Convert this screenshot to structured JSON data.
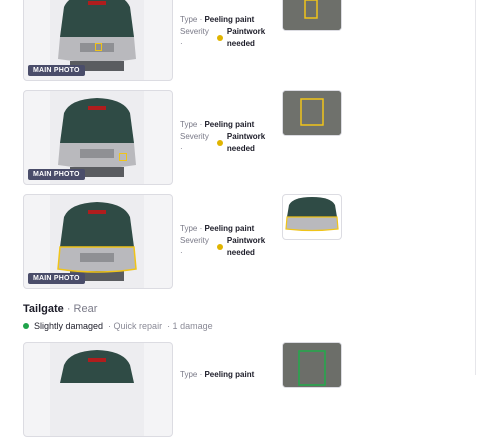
{
  "damages": [
    {
      "badge": "MAIN PHOTO",
      "type_label": "Type ·",
      "type_value": "Peeling paint",
      "severity_label": "Severity",
      "severity_dot": "·",
      "severity_value_1": "Paintwork",
      "severity_value_2": "needed",
      "marker_color": "#f0c419"
    },
    {
      "badge": "MAIN PHOTO",
      "type_label": "Type ·",
      "type_value": "Peeling paint",
      "severity_label": "Severity",
      "severity_dot": "·",
      "severity_value_1": "Paintwork",
      "severity_value_2": "needed",
      "marker_color": "#f0c419"
    },
    {
      "badge": "MAIN PHOTO",
      "type_label": "Type ·",
      "type_value": "Peeling paint",
      "severity_label": "Severity",
      "severity_dot": "·",
      "severity_value_1": "Paintwork",
      "severity_value_2": "needed",
      "marker_color": "#f0c419"
    },
    {
      "badge": "",
      "type_label": "Type ·",
      "type_value": "Peeling paint",
      "marker_color": "#22aa4a"
    }
  ],
  "section": {
    "title": "Tailgate",
    "subtitle": "· Rear",
    "status": "Slightly damaged",
    "repair": "· Quick repair",
    "count": "· 1 damage",
    "status_color": "#1fa34a"
  },
  "icons": {
    "severity": "yellow-dot-icon",
    "status": "green-dot-icon"
  }
}
